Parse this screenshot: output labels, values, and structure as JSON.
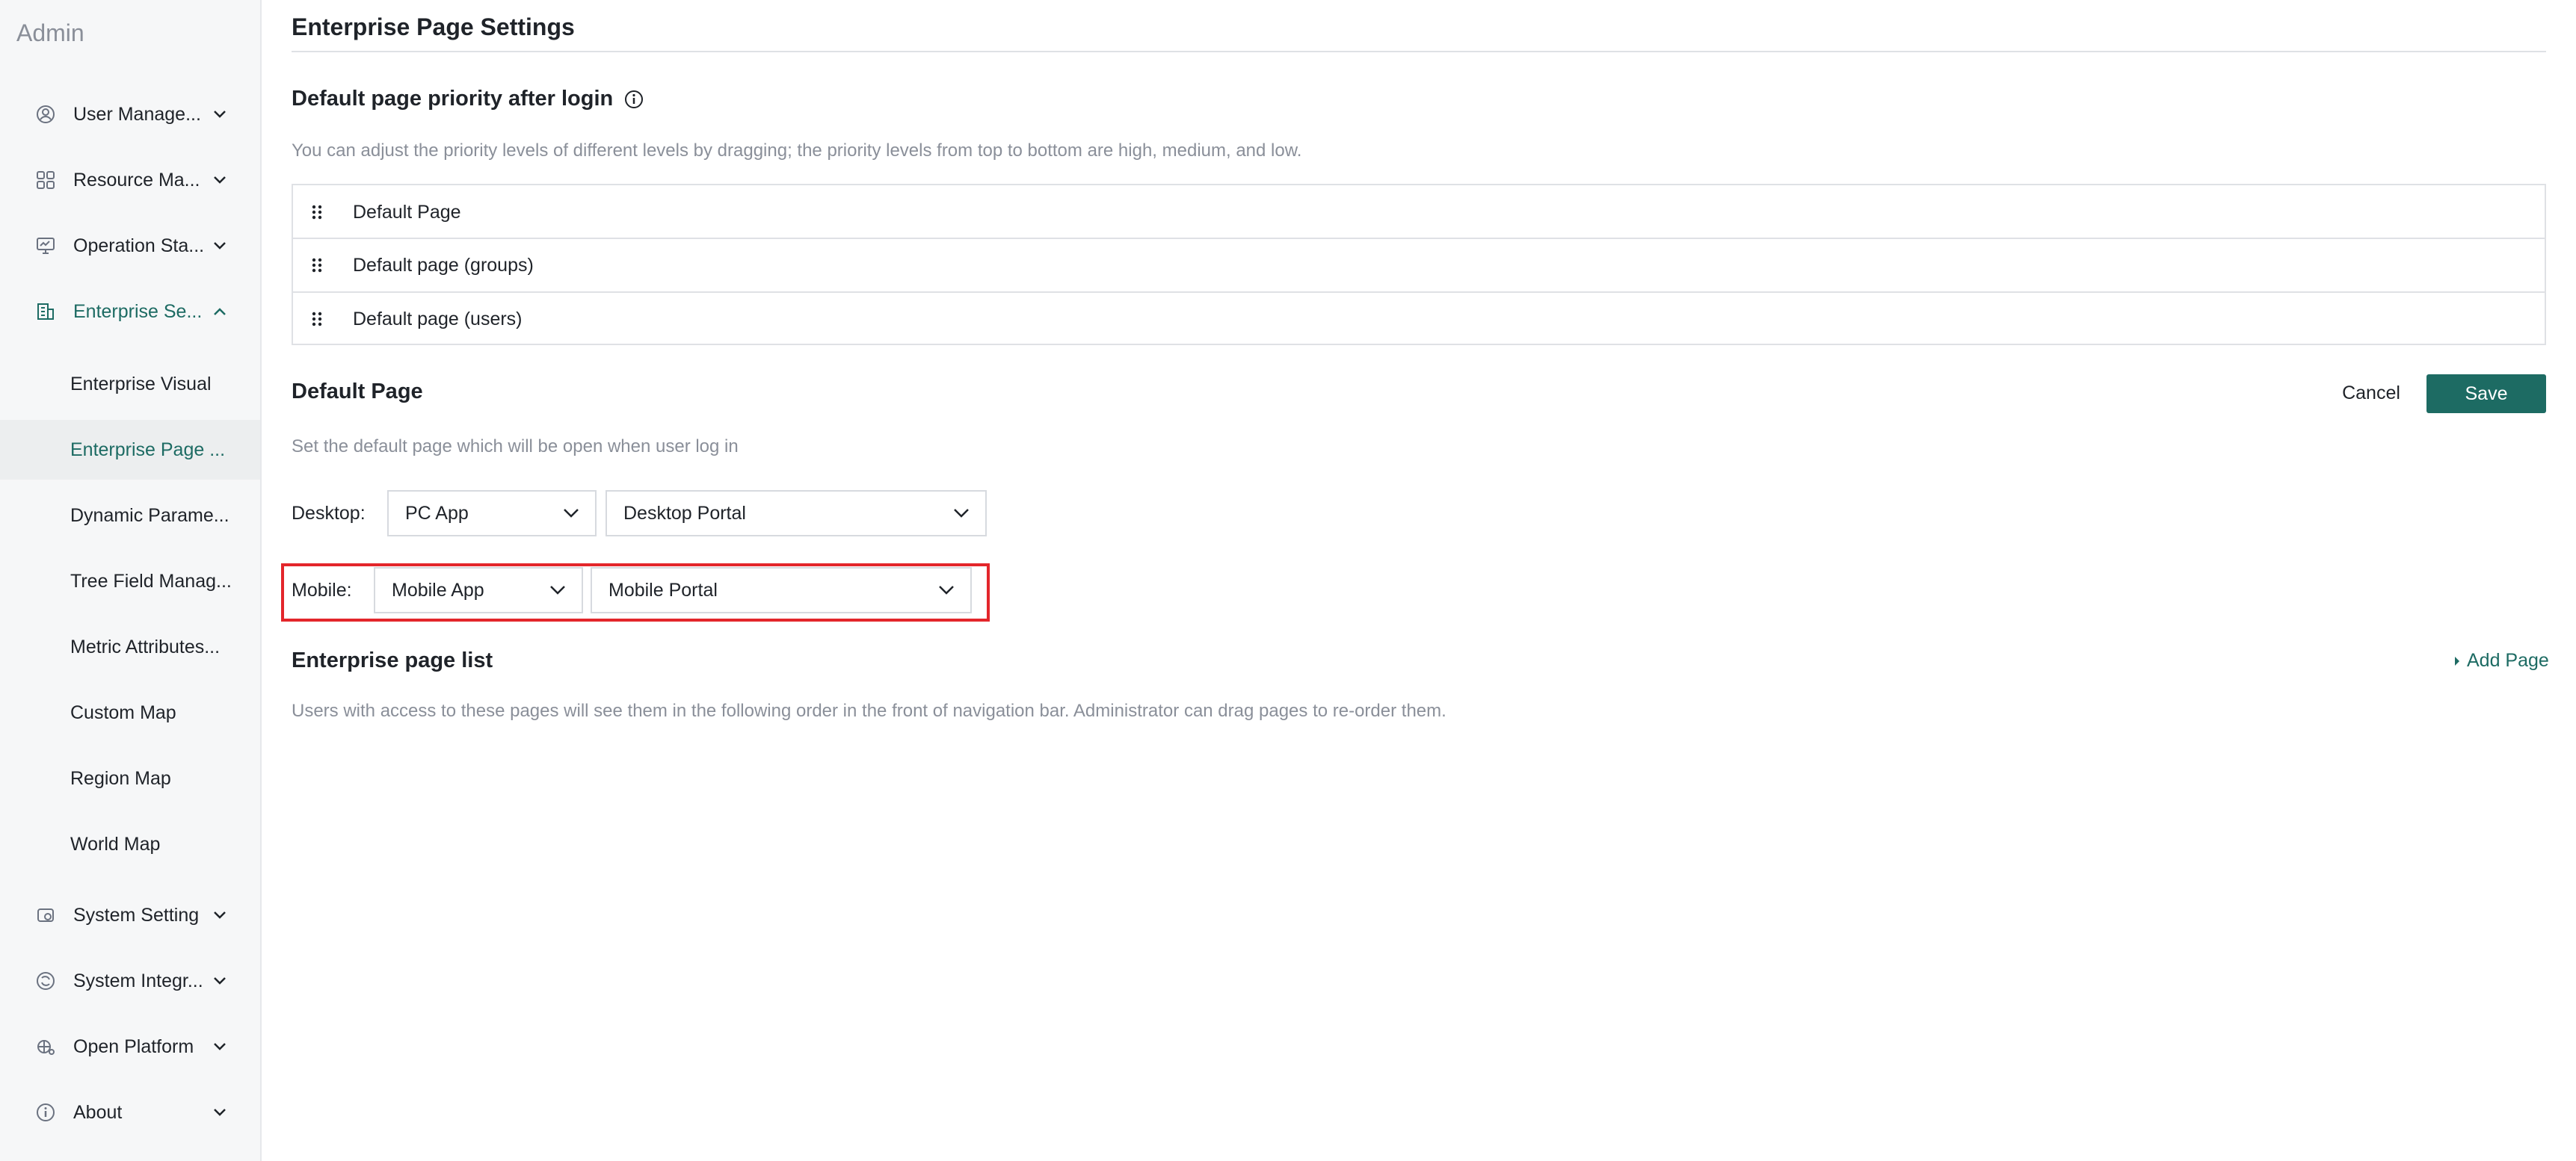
{
  "sidebar": {
    "brand": "Admin",
    "items": [
      {
        "label": "User Manage...",
        "icon": "user-icon"
      },
      {
        "label": "Resource Ma...",
        "icon": "grid-icon"
      },
      {
        "label": "Operation Sta...",
        "icon": "monitor-icon"
      },
      {
        "label": "Enterprise Se...",
        "icon": "building-icon",
        "expanded": true
      }
    ],
    "sub_items": [
      {
        "label": "Enterprise Visual"
      },
      {
        "label": "Enterprise Page ...",
        "selected": true
      },
      {
        "label": "Dynamic Parame..."
      },
      {
        "label": "Tree Field Manag..."
      },
      {
        "label": "Metric Attributes..."
      },
      {
        "label": "Custom Map"
      },
      {
        "label": "Region Map"
      },
      {
        "label": "World Map"
      }
    ],
    "items_bottom": [
      {
        "label": "System Setting",
        "icon": "settings-icon"
      },
      {
        "label": "System Integr...",
        "icon": "integration-icon"
      },
      {
        "label": "Open Platform",
        "icon": "platform-icon"
      },
      {
        "label": "About",
        "icon": "info-icon"
      }
    ]
  },
  "main": {
    "title": "Enterprise Page Settings",
    "priority": {
      "title": "Default page priority after login",
      "description": "You can adjust the priority levels of different levels by dragging; the priority levels from top to bottom are high, medium, and low.",
      "rows": [
        "Default Page",
        "Default page (groups)",
        "Default page (users)"
      ]
    },
    "default_page": {
      "title": "Default Page",
      "description": "Set the default page which will be open when user log in",
      "cancel_label": "Cancel",
      "save_label": "Save",
      "desktop": {
        "label": "Desktop:",
        "app": "PC App",
        "portal": "Desktop Portal"
      },
      "mobile": {
        "label": "Mobile:",
        "app": "Mobile App",
        "portal": "Mobile Portal"
      }
    },
    "page_list": {
      "title": "Enterprise page list",
      "add_label": "Add Page",
      "description": "Users with access to these pages will see them in the following order in the front of navigation bar. Administrator can drag pages to re-order them."
    }
  },
  "colors": {
    "accent": "#1d6b63",
    "highlight": "#e3262b",
    "sidebar_bg": "#f6f7f8"
  }
}
